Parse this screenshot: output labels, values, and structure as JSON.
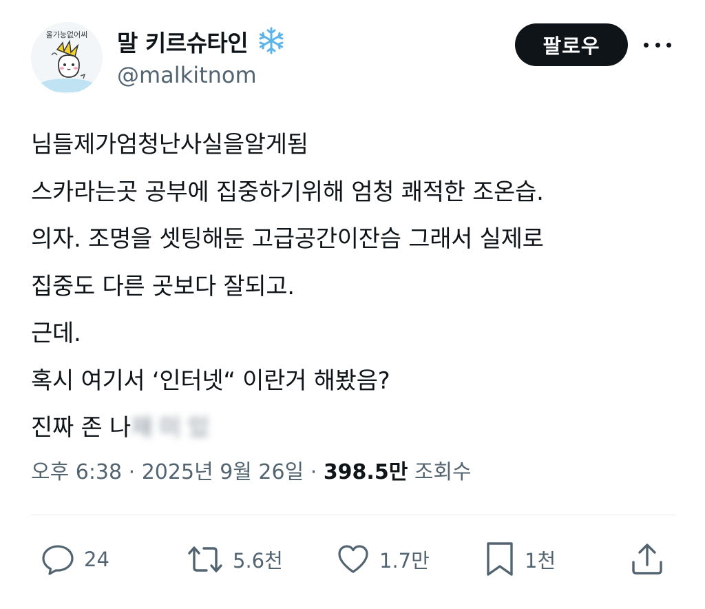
{
  "author": {
    "display_name": "말 키르슈타인",
    "handle": "@malkitnom",
    "avatar_caption": "울가능없어씨"
  },
  "header": {
    "follow_label": "팔로우",
    "more_icon": "more-icon"
  },
  "tweet": {
    "lines": [
      "님들제가엄청난사실을알게됨",
      "스카라는곳 공부에 집중하기위해 엄청 쾌적한 조온습.",
      "의자. 조명을 셋팅해둔 고급공간이잔슴 그래서 실제로",
      "집중도 다른 곳보다 잘되고.",
      "근데.",
      "혹시 여기서 ‘인터넷“ 이란거 해봤음?"
    ],
    "last_line_visible": "진짜 존 나",
    "last_line_blurred": "재 미 있"
  },
  "meta": {
    "time": "오후 6:38",
    "separator": " · ",
    "date": "2025년 9월 26일",
    "views_count": "398.5만",
    "views_label": "조회수"
  },
  "actions": {
    "reply": {
      "icon": "reply-icon",
      "count": "24"
    },
    "retweet": {
      "icon": "retweet-icon",
      "count": "5.6천"
    },
    "like": {
      "icon": "like-icon",
      "count": "1.7만"
    },
    "bookmark": {
      "icon": "bookmark-icon",
      "count": "1천"
    },
    "share": {
      "icon": "share-icon"
    }
  },
  "colors": {
    "text": "#0f1419",
    "secondary": "#536471",
    "divider": "#e6e9eb",
    "follow_bg": "#0f1419",
    "snowflake": "#5bb3e8"
  }
}
